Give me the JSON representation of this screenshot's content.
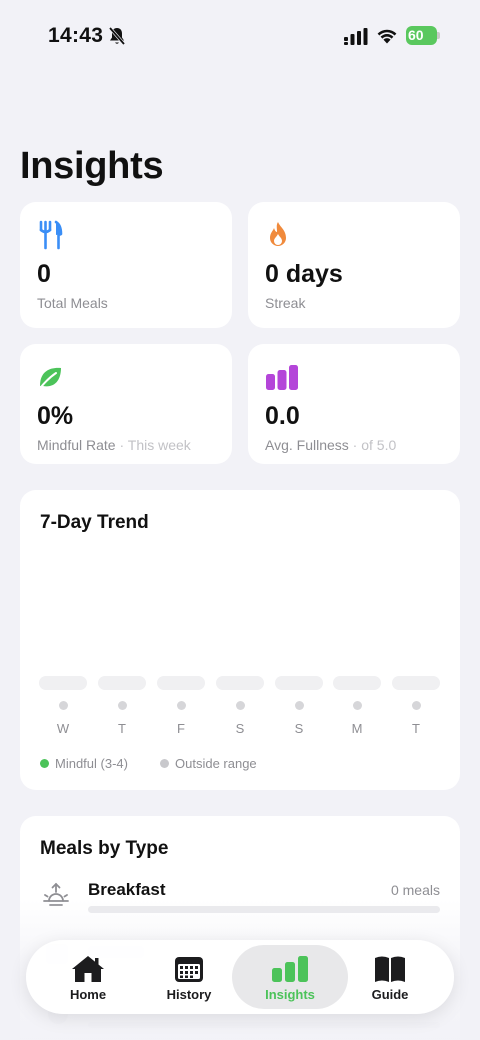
{
  "status_bar": {
    "time": "14:43",
    "battery": "60"
  },
  "page": {
    "title": "Insights"
  },
  "stats": [
    {
      "value": "0",
      "label": "Total Meals",
      "sub": "",
      "icon": "fork-knife-icon",
      "color": "#3a8ef6"
    },
    {
      "value": "0 days",
      "label": "Streak",
      "sub": "",
      "icon": "flame-icon",
      "color": "#f08a3c"
    },
    {
      "value": "0%",
      "label": "Mindful Rate",
      "sub": " · This week",
      "icon": "leaf-icon",
      "color": "#4cc35a"
    },
    {
      "value": "0.0",
      "label": "Avg. Fullness",
      "sub": " · of 5.0",
      "icon": "bar-chart-icon",
      "color": "#b445d9"
    }
  ],
  "trend": {
    "title": "7-Day Trend",
    "days": [
      "W",
      "T",
      "F",
      "S",
      "S",
      "M",
      "T"
    ],
    "legend": [
      {
        "label": "Mindful (3-4)",
        "color": "#4cc35a"
      },
      {
        "label": "Outside range",
        "color": "#c8c8cc"
      }
    ]
  },
  "meals_by_type": {
    "title": "Meals by Type",
    "rows": [
      {
        "label": "Breakfast",
        "count": "0 meals",
        "fraction": 0,
        "icon": "sunrise-icon"
      }
    ]
  },
  "tabbar": {
    "tabs": [
      {
        "label": "Home",
        "icon": "house-icon",
        "active": false
      },
      {
        "label": "History",
        "icon": "calendar-icon",
        "active": false
      },
      {
        "label": "Insights",
        "icon": "bar-chart-icon",
        "active": true
      },
      {
        "label": "Guide",
        "icon": "book-icon",
        "active": false
      }
    ],
    "accent": "#4cc35a"
  }
}
